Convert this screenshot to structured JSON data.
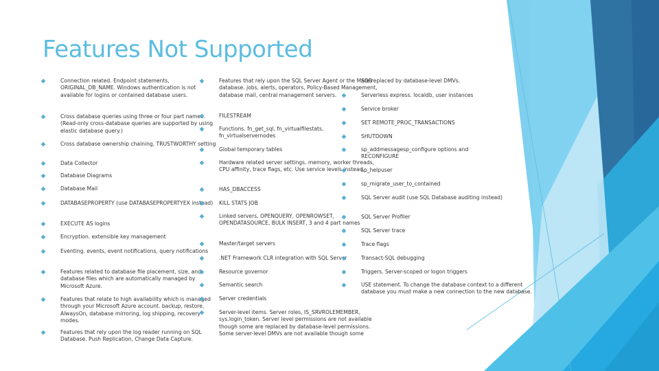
{
  "slide": {
    "title": "Features Not Supported",
    "accent_color": "#5bbde0",
    "bullet_icon": "diamond-bullet"
  },
  "columns": [
    {
      "items": [
        "Connection related. Endpoint statements, ORIGINAL_DB_NAME. Windows authentication is not available for logins or contained database users.",
        "Cross database queries using three or four part names. (Read-only cross-database queries are supported by using elastic database query.)",
        "Cross database ownership chaining, TRUSTWORTHY setting",
        "Data Collector",
        "Database Diagrams",
        "Database Mail",
        "DATABASEPROPERTY (use DATABASEPROPERTYEX instead)",
        "EXECUTE AS logins",
        "Encryption. extensible key management",
        "Eventing. events, event notifications, query notifications",
        "Features related to database file placement, size, and database files which are automatically managed by Microsoft Azure.",
        "Features that relate to high availability which is managed through your Microsoft Azure account. backup, restore, AlwaysOn, database mirroring, log shipping, recovery modes.",
        "Features that rely upon the log reader running on SQL Database. Push Replication, Change Data Capture."
      ]
    },
    {
      "items": [
        "Features that rely upon the SQL Server Agent or the MSDB database. jobs, alerts, operators, Policy-Based Management, database mail, central management servers.",
        "FILESTREAM",
        "Functions. fn_get_sql, fn_virtualfilestats, fn_virtualservernodes",
        "Global temporary tables",
        "Hardware related server settings. memory, worker threads, CPU affinity, trace flags, etc. Use service levels instead.",
        "HAS_DBACCESS",
        "KILL STATS JOB",
        "Linked servers, OPENQUERY, OPENROWSET, OPENDATASOURCE, BULK INSERT, 3 and 4 part names",
        "Master/target servers",
        ".NET Framework CLR integration with SQL Server",
        "Resource governor",
        "Semantic search",
        "Server credentials",
        "Server-level items. Server roles, IS_SRVROLEMEMBER, sys.login_token. Server level permissions are not available though some are replaced by database-level permissions. Some server-level DMVs are not available though some"
      ]
    },
    {
      "continuation": "are replaced by database-level DMVs.",
      "items": [
        "Serverless express. localdb, user instances",
        "Service broker",
        "SET REMOTE_PROC_TRANSACTIONS",
        "SHUTDOWN",
        "sp_addmessagesp_configure options and RECONFIGURE",
        "sp_helpuser",
        "sp_migrate_user_to_contained",
        "SQL Server audit (use SQL Database auditing instead)",
        "SQL Server Profiler",
        "SQL Server trace",
        "Trace flags",
        "Transact-SQL debugging",
        "Triggers. Server-scoped or logon triggers",
        "USE statement. To change the database context to a different database you must make a new connection to the new database."
      ]
    }
  ]
}
